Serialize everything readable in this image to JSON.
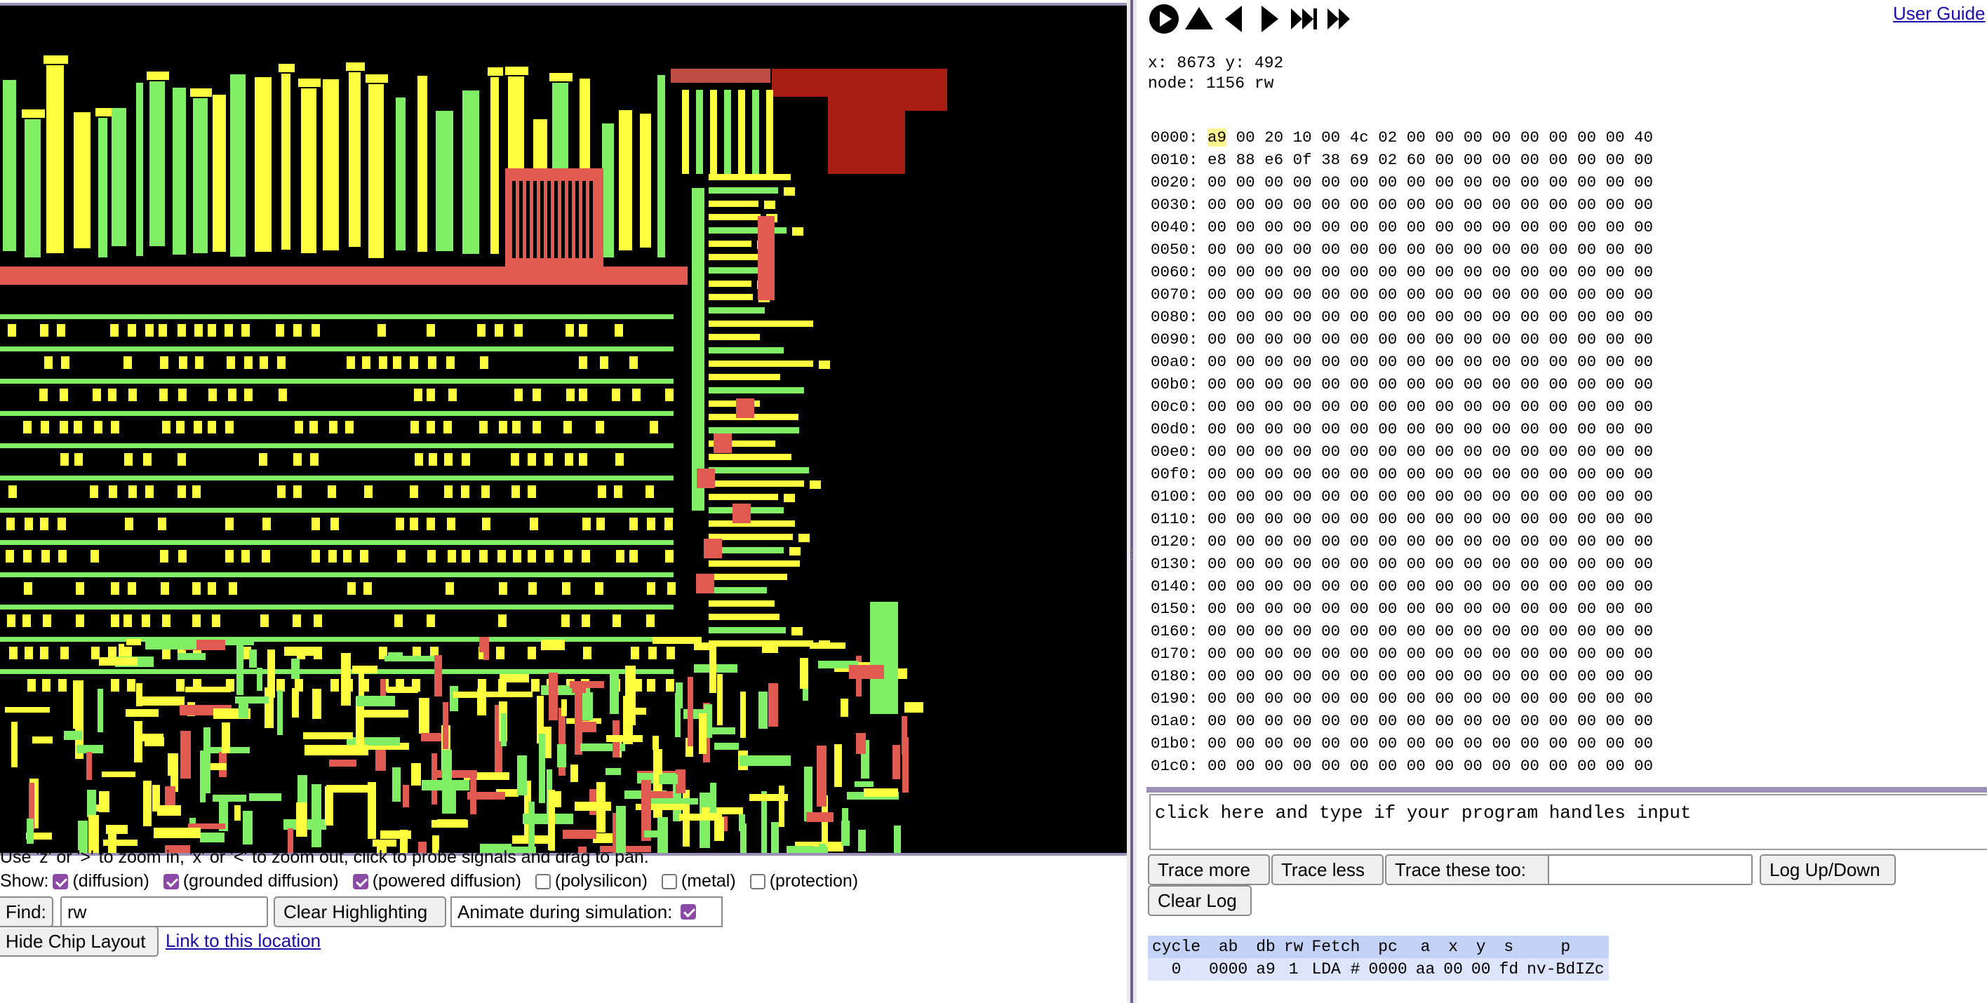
{
  "chip": {
    "help_text": "Use 'z' or '>' to zoom in, 'x' or '<' to zoom out, click to probe signals and drag to pan.",
    "layer_colors": {
      "diffusion": "#ffff40",
      "grounded": "#80ef66",
      "powered": "#e05a52",
      "highlight": "#a81e14"
    },
    "show_label": "Show:",
    "layers": [
      {
        "label": "(diffusion)",
        "checked": true
      },
      {
        "label": "(grounded diffusion)",
        "checked": true
      },
      {
        "label": "(powered diffusion)",
        "checked": true
      },
      {
        "label": "(polysilicon)",
        "checked": false
      },
      {
        "label": "(metal)",
        "checked": false
      },
      {
        "label": "(protection)",
        "checked": false
      }
    ],
    "find_button": "Find:",
    "find_value": "rw",
    "clear_highlighting": "Clear Highlighting",
    "animate_label": "Animate during simulation:",
    "animate_checked": true,
    "hide_chip_layout": "Hide Chip Layout",
    "link_location": "Link to this location"
  },
  "controls": {
    "icons": [
      "play-icon",
      "step-up-icon",
      "step-back-icon",
      "step-forward-icon",
      "fast-forward-end-icon",
      "fast-forward-icon"
    ],
    "user_guide": "User Guide"
  },
  "probe": {
    "line1": "x: 8673 y: 492",
    "line2": "node: 1156 rw"
  },
  "memory": {
    "rows": [
      {
        "addr": "0000:",
        "bytes": [
          "a9",
          "00",
          "20",
          "10",
          "00",
          "4c",
          "02",
          "00",
          "00",
          "00",
          "00",
          "00",
          "00",
          "00",
          "00",
          "40"
        ]
      },
      {
        "addr": "0010:",
        "bytes": [
          "e8",
          "88",
          "e6",
          "0f",
          "38",
          "69",
          "02",
          "60",
          "00",
          "00",
          "00",
          "00",
          "00",
          "00",
          "00",
          "00"
        ]
      },
      {
        "addr": "0020:",
        "bytes": [
          "00",
          "00",
          "00",
          "00",
          "00",
          "00",
          "00",
          "00",
          "00",
          "00",
          "00",
          "00",
          "00",
          "00",
          "00",
          "00"
        ]
      },
      {
        "addr": "0030:",
        "bytes": [
          "00",
          "00",
          "00",
          "00",
          "00",
          "00",
          "00",
          "00",
          "00",
          "00",
          "00",
          "00",
          "00",
          "00",
          "00",
          "00"
        ]
      },
      {
        "addr": "0040:",
        "bytes": [
          "00",
          "00",
          "00",
          "00",
          "00",
          "00",
          "00",
          "00",
          "00",
          "00",
          "00",
          "00",
          "00",
          "00",
          "00",
          "00"
        ]
      },
      {
        "addr": "0050:",
        "bytes": [
          "00",
          "00",
          "00",
          "00",
          "00",
          "00",
          "00",
          "00",
          "00",
          "00",
          "00",
          "00",
          "00",
          "00",
          "00",
          "00"
        ]
      },
      {
        "addr": "0060:",
        "bytes": [
          "00",
          "00",
          "00",
          "00",
          "00",
          "00",
          "00",
          "00",
          "00",
          "00",
          "00",
          "00",
          "00",
          "00",
          "00",
          "00"
        ]
      },
      {
        "addr": "0070:",
        "bytes": [
          "00",
          "00",
          "00",
          "00",
          "00",
          "00",
          "00",
          "00",
          "00",
          "00",
          "00",
          "00",
          "00",
          "00",
          "00",
          "00"
        ]
      },
      {
        "addr": "0080:",
        "bytes": [
          "00",
          "00",
          "00",
          "00",
          "00",
          "00",
          "00",
          "00",
          "00",
          "00",
          "00",
          "00",
          "00",
          "00",
          "00",
          "00"
        ]
      },
      {
        "addr": "0090:",
        "bytes": [
          "00",
          "00",
          "00",
          "00",
          "00",
          "00",
          "00",
          "00",
          "00",
          "00",
          "00",
          "00",
          "00",
          "00",
          "00",
          "00"
        ]
      },
      {
        "addr": "00a0:",
        "bytes": [
          "00",
          "00",
          "00",
          "00",
          "00",
          "00",
          "00",
          "00",
          "00",
          "00",
          "00",
          "00",
          "00",
          "00",
          "00",
          "00"
        ]
      },
      {
        "addr": "00b0:",
        "bytes": [
          "00",
          "00",
          "00",
          "00",
          "00",
          "00",
          "00",
          "00",
          "00",
          "00",
          "00",
          "00",
          "00",
          "00",
          "00",
          "00"
        ]
      },
      {
        "addr": "00c0:",
        "bytes": [
          "00",
          "00",
          "00",
          "00",
          "00",
          "00",
          "00",
          "00",
          "00",
          "00",
          "00",
          "00",
          "00",
          "00",
          "00",
          "00"
        ]
      },
      {
        "addr": "00d0:",
        "bytes": [
          "00",
          "00",
          "00",
          "00",
          "00",
          "00",
          "00",
          "00",
          "00",
          "00",
          "00",
          "00",
          "00",
          "00",
          "00",
          "00"
        ]
      },
      {
        "addr": "00e0:",
        "bytes": [
          "00",
          "00",
          "00",
          "00",
          "00",
          "00",
          "00",
          "00",
          "00",
          "00",
          "00",
          "00",
          "00",
          "00",
          "00",
          "00"
        ]
      },
      {
        "addr": "00f0:",
        "bytes": [
          "00",
          "00",
          "00",
          "00",
          "00",
          "00",
          "00",
          "00",
          "00",
          "00",
          "00",
          "00",
          "00",
          "00",
          "00",
          "00"
        ]
      },
      {
        "addr": "0100:",
        "bytes": [
          "00",
          "00",
          "00",
          "00",
          "00",
          "00",
          "00",
          "00",
          "00",
          "00",
          "00",
          "00",
          "00",
          "00",
          "00",
          "00"
        ]
      },
      {
        "addr": "0110:",
        "bytes": [
          "00",
          "00",
          "00",
          "00",
          "00",
          "00",
          "00",
          "00",
          "00",
          "00",
          "00",
          "00",
          "00",
          "00",
          "00",
          "00"
        ]
      },
      {
        "addr": "0120:",
        "bytes": [
          "00",
          "00",
          "00",
          "00",
          "00",
          "00",
          "00",
          "00",
          "00",
          "00",
          "00",
          "00",
          "00",
          "00",
          "00",
          "00"
        ]
      },
      {
        "addr": "0130:",
        "bytes": [
          "00",
          "00",
          "00",
          "00",
          "00",
          "00",
          "00",
          "00",
          "00",
          "00",
          "00",
          "00",
          "00",
          "00",
          "00",
          "00"
        ]
      },
      {
        "addr": "0140:",
        "bytes": [
          "00",
          "00",
          "00",
          "00",
          "00",
          "00",
          "00",
          "00",
          "00",
          "00",
          "00",
          "00",
          "00",
          "00",
          "00",
          "00"
        ]
      },
      {
        "addr": "0150:",
        "bytes": [
          "00",
          "00",
          "00",
          "00",
          "00",
          "00",
          "00",
          "00",
          "00",
          "00",
          "00",
          "00",
          "00",
          "00",
          "00",
          "00"
        ]
      },
      {
        "addr": "0160:",
        "bytes": [
          "00",
          "00",
          "00",
          "00",
          "00",
          "00",
          "00",
          "00",
          "00",
          "00",
          "00",
          "00",
          "00",
          "00",
          "00",
          "00"
        ]
      },
      {
        "addr": "0170:",
        "bytes": [
          "00",
          "00",
          "00",
          "00",
          "00",
          "00",
          "00",
          "00",
          "00",
          "00",
          "00",
          "00",
          "00",
          "00",
          "00",
          "00"
        ]
      },
      {
        "addr": "0180:",
        "bytes": [
          "00",
          "00",
          "00",
          "00",
          "00",
          "00",
          "00",
          "00",
          "00",
          "00",
          "00",
          "00",
          "00",
          "00",
          "00",
          "00"
        ]
      },
      {
        "addr": "0190:",
        "bytes": [
          "00",
          "00",
          "00",
          "00",
          "00",
          "00",
          "00",
          "00",
          "00",
          "00",
          "00",
          "00",
          "00",
          "00",
          "00",
          "00"
        ]
      },
      {
        "addr": "01a0:",
        "bytes": [
          "00",
          "00",
          "00",
          "00",
          "00",
          "00",
          "00",
          "00",
          "00",
          "00",
          "00",
          "00",
          "00",
          "00",
          "00",
          "00"
        ]
      },
      {
        "addr": "01b0:",
        "bytes": [
          "00",
          "00",
          "00",
          "00",
          "00",
          "00",
          "00",
          "00",
          "00",
          "00",
          "00",
          "00",
          "00",
          "00",
          "00",
          "00"
        ]
      },
      {
        "addr": "01c0:",
        "bytes": [
          "00",
          "00",
          "00",
          "00",
          "00",
          "00",
          "00",
          "00",
          "00",
          "00",
          "00",
          "00",
          "00",
          "00",
          "00",
          "00"
        ]
      }
    ],
    "highlight_byte": "a9"
  },
  "input_area": {
    "placeholder": "click here and type if your program handles input"
  },
  "trace": {
    "trace_more": "Trace more",
    "trace_less": "Trace less",
    "trace_these_too": "Trace these too:",
    "trace_value": "",
    "log_up_down": "Log Up/Down",
    "clear_log": "Clear Log"
  },
  "status_table": {
    "headers": [
      "cycle",
      "ab",
      "db",
      "rw",
      "Fetch",
      "pc",
      "a",
      "x",
      "y",
      "s",
      "p"
    ],
    "row": [
      "0",
      "0000",
      "a9",
      "1",
      "LDA #",
      "0000",
      "aa",
      "00",
      "00",
      "fd",
      "nv‑BdIZc"
    ]
  }
}
